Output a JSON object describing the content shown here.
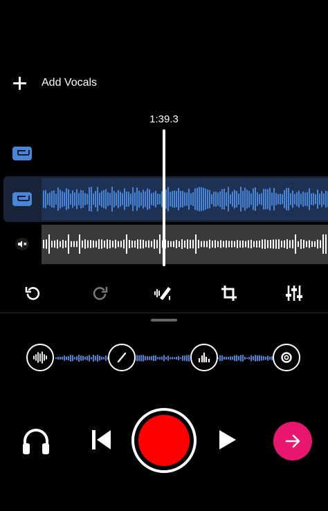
{
  "add_vocals": {
    "label": "Add Vocals",
    "icon": "plus-icon"
  },
  "playhead": {
    "time": "1:39.3"
  },
  "tracks": [
    {
      "name": "track-1",
      "icon": "cassette-icon",
      "selected": false
    },
    {
      "name": "track-2",
      "icon": "cassette-icon",
      "selected": true,
      "color": "#4a86d8"
    },
    {
      "name": "track-3",
      "icon": "speaker-muted-icon",
      "muted": true,
      "color": "#ffffff"
    }
  ],
  "edit_toolbar": [
    "undo-icon",
    "redo-icon",
    "magic-pen-icon",
    "crop-icon",
    "sliders-icon"
  ],
  "effects": [
    "waveform-icon",
    "slash-icon",
    "equalizer-icon",
    "ring-icon"
  ],
  "transport": [
    "headphones-icon",
    "skip-back-icon",
    "record-button",
    "play-icon",
    "arrow-right-icon"
  ],
  "colors": {
    "accent": "#e8166e",
    "record": "#fe0000",
    "track_blue": "#4a86d8"
  }
}
